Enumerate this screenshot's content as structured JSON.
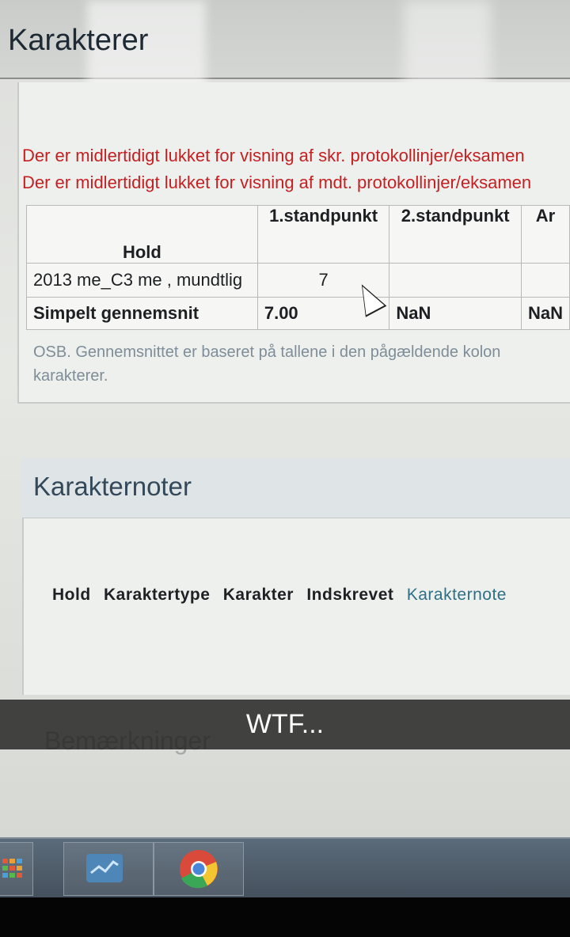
{
  "page": {
    "title": "Karakterer"
  },
  "warnings": [
    "Der er midlertidigt lukket for visning af skr. protokollinjer/eksamen",
    "Der er midlertidigt lukket for visning af mdt. protokollinjer/eksamen"
  ],
  "grades_table": {
    "headers": [
      "Hold",
      "1.standpunkt",
      "2.standpunkt",
      "Ar"
    ],
    "rows": [
      [
        "2013 me_C3 me ,  mundtlig",
        "7",
        "",
        ""
      ],
      [
        "Simpelt gennemsnit",
        "7.00",
        "NaN",
        "NaN"
      ]
    ]
  },
  "note": "OSB. Gennemsnittet er baseret på tallene i den pågældende kolon karakterer.",
  "karakternoter": {
    "title": "Karakternoter",
    "columns": [
      "Hold",
      "Karaktertype",
      "Karakter",
      "Indskrevet",
      "Karakternote"
    ]
  },
  "ghost_heading": "Bemærkninger",
  "caption": "WTF...",
  "taskbar": {
    "items": [
      "start-grid-icon",
      "taskbar-app-icon",
      "chrome-icon"
    ]
  },
  "colors": {
    "warning": "#c51f22",
    "link": "#2f6f86",
    "caption_bg": "#1e1e1e"
  }
}
